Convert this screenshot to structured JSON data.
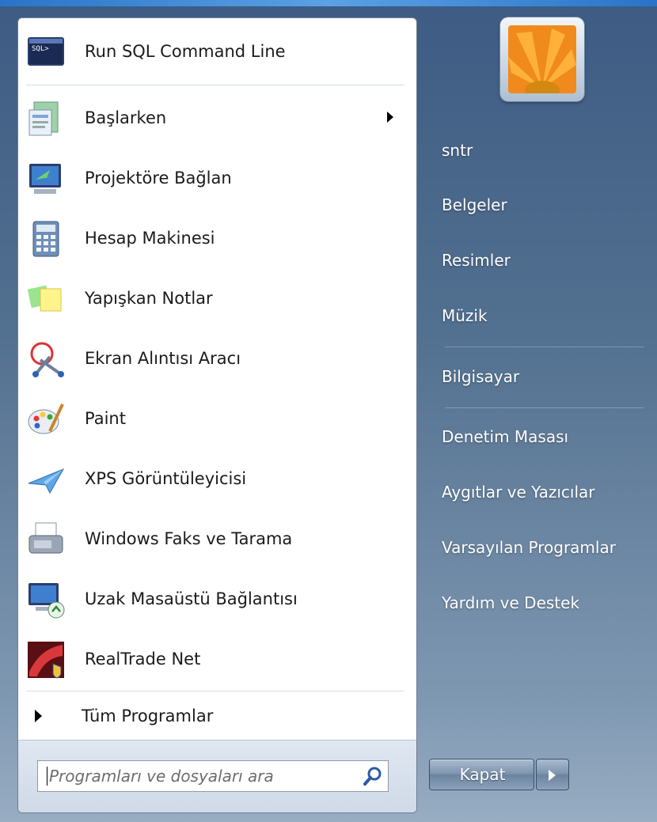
{
  "start_menu": {
    "pinned": [
      {
        "label": "Run SQL Command Line",
        "icon": "sql-console-icon"
      }
    ],
    "recent": [
      {
        "label": "Başlarken",
        "icon": "getting-started-icon",
        "has_submenu": true
      },
      {
        "label": "Projektöre Bağlan",
        "icon": "projector-icon"
      },
      {
        "label": "Hesap Makinesi",
        "icon": "calculator-icon"
      },
      {
        "label": "Yapışkan Notlar",
        "icon": "sticky-notes-icon"
      },
      {
        "label": "Ekran Alıntısı Aracı",
        "icon": "snipping-tool-icon"
      },
      {
        "label": "Paint",
        "icon": "paint-palette-icon"
      },
      {
        "label": "XPS Görüntüleyicisi",
        "icon": "xps-viewer-icon"
      },
      {
        "label": "Windows Faks ve Tarama",
        "icon": "fax-scanner-icon"
      },
      {
        "label": "Uzak Masaüstü Bağlantısı",
        "icon": "remote-desktop-icon"
      },
      {
        "label": "RealTrade Net",
        "icon": "realtrade-icon"
      }
    ],
    "all_programs": "Tüm Programlar",
    "search": {
      "placeholder": "Programları ve dosyaları ara"
    },
    "right": {
      "user": "sntr",
      "links": [
        "Belgeler",
        "Resimler",
        "Müzik",
        "Bilgisayar",
        "Denetim Masası",
        "Aygıtlar ve Yazıcılar",
        "Varsayılan Programlar",
        "Yardım ve Destek"
      ]
    },
    "shutdown_label": "Kapat"
  },
  "colors": {
    "accent": "#2a73c9",
    "panel": "#4f6e95"
  }
}
